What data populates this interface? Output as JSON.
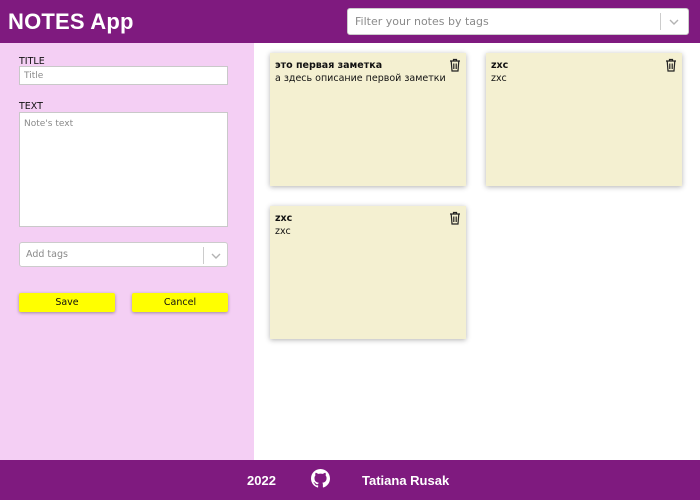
{
  "header": {
    "title": "NOTES App",
    "filter_placeholder": "Filter your notes by tags"
  },
  "form": {
    "title_label": "TITLE",
    "title_placeholder": "Title",
    "text_label": "TEXT",
    "text_placeholder": "Note's text",
    "tags_placeholder": "Add tags",
    "save_label": "Save",
    "cancel_label": "Cancel"
  },
  "notes": [
    {
      "title": "это первая заметка",
      "text": "а здесь описание первой заметки"
    },
    {
      "title": "zxc",
      "text": "zxc"
    },
    {
      "title": "zxc",
      "text": "zxc"
    }
  ],
  "footer": {
    "year": "2022",
    "author": "Tatiana Rusak"
  },
  "colors": {
    "brand": "#7f1a7f",
    "sidebar": "#f4cff4",
    "note": "#f4f0d1",
    "button": "#ffff00"
  },
  "icons": [
    "trash-icon",
    "chevron-down-icon",
    "github-icon"
  ]
}
